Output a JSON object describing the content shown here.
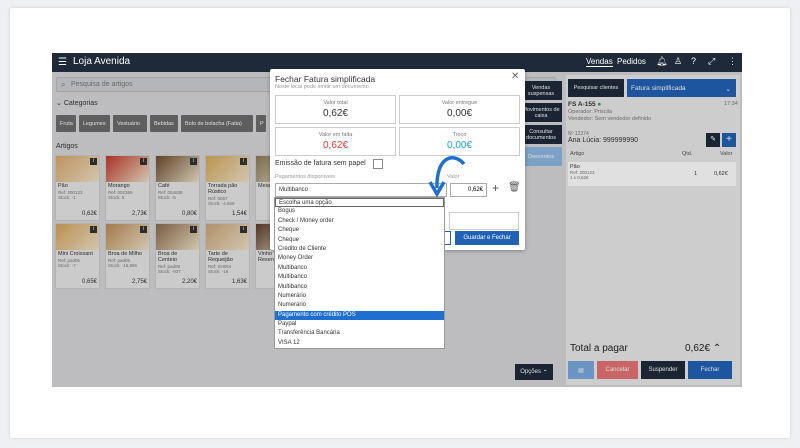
{
  "app": {
    "title": "Loja Avenida",
    "nav_vendas": "Vendas",
    "nav_pedidos": "Pedidos"
  },
  "search": {
    "placeholder": "Pesquisa de artigos"
  },
  "categories": {
    "title": "Categorias",
    "items": [
      "Fruta",
      "Legumes",
      "Vestuário",
      "Bebidas",
      "Bolo de bolacha (Fatia)",
      "P"
    ]
  },
  "articles": {
    "title": "Artigos",
    "items": [
      {
        "name": "Pão",
        "ref": "Ref: 200123",
        "stock": "Stock: -1",
        "price": "0,62€"
      },
      {
        "name": "Morango",
        "ref": "Ref: 002369",
        "stock": "Stock: 5",
        "price": "2,73€"
      },
      {
        "name": "Café",
        "ref": "Ref: 004638",
        "stock": "Stock: -5",
        "price": "0,80€"
      },
      {
        "name": "Torrada pão Rústico",
        "ref": "Ref: 0067",
        "stock": "Stock: -4,669",
        "price": "1,54€"
      },
      {
        "name": "Meia",
        "ref": "",
        "stock": "",
        "price": ""
      },
      {
        "name": "Mini Croissant",
        "ref": "Ref: pad05",
        "stock": "Stock: -7",
        "price": "0,65€"
      },
      {
        "name": "Broa de Milho",
        "ref": "Ref: pad06",
        "stock": "Stock: -16,956",
        "price": "2,75€"
      },
      {
        "name": "Broa de Centeio",
        "ref": "Ref: pad09",
        "stock": "Stock: -937",
        "price": "2,20€"
      },
      {
        "name": "Tarte de Requeijão",
        "ref": "Ref: SH064",
        "stock": "Stock: -16",
        "price": "1,63€"
      },
      {
        "name": "Vinho T Reserva unidad",
        "ref": "",
        "stock": "",
        "price": ""
      }
    ]
  },
  "side_buttons": [
    "Vendas suspensas",
    "Movimentos de caixa",
    "Consultar documentos",
    "Descontos"
  ],
  "opcoes": "Opções",
  "ticket": {
    "pesquisar": "Pesquisar clientes",
    "doc_type": "Fatura simplificada",
    "fs": "FS A-155",
    "operador": "Operador: Priscila",
    "vendedor": "Vendedor: Sem vendedor definido",
    "time": "17:34",
    "nif": "Nº 12374",
    "cliente": "Ana Lúcia: 999999990",
    "col_artigo": "Artigo",
    "col_qtd": "Qtd.",
    "col_valor": "Valor",
    "line_name": "Pão",
    "line_ref": "Ref: 200123",
    "line_unit": "1 x 0,62€",
    "line_qtd": "1",
    "line_valor": "0,62€",
    "total_label": "Total a pagar",
    "total_value": "0,62€",
    "cancelar": "Cancelar",
    "suspender": "Suspender",
    "fechar": "Fechar"
  },
  "modal": {
    "title": "Fechar Fatura simplificada",
    "subtitle": "Neste local pode emitir um documento",
    "valor_total_label": "Valor total",
    "valor_total": "0,62€",
    "valor_entregue_label": "Valor entregue",
    "valor_entregue": "0,00€",
    "valor_falta_label": "Valor em falta",
    "valor_falta": "0,62€",
    "troco_label": "Troco",
    "troco": "0,00€",
    "emissao": "Emissão de fatura sem papel",
    "pagamentos_label": "Pagamentos disponíveis",
    "valor_label": "Valor",
    "selected": "Multibanco",
    "valor": "0,62€",
    "guardar": "Guardar e Fechar"
  },
  "dropdown": [
    "Escolha uma opção",
    "Bogus",
    "Check / Money order",
    "Cheque",
    "Cheque",
    "Crédito de Cliente",
    "Money Order",
    "Multibanco",
    "Multibanco",
    "Multibanco",
    "Numerário",
    "Numerário",
    "Pagamento com crédito POS",
    "Paypal",
    "Transferência Bancária",
    "VISA 12"
  ],
  "dropdown_selected_index": 12,
  "colors": {
    "dark": "#1e2a3a",
    "blue": "#2162b5",
    "red": "#e53935",
    "teal": "#19a3c4"
  }
}
